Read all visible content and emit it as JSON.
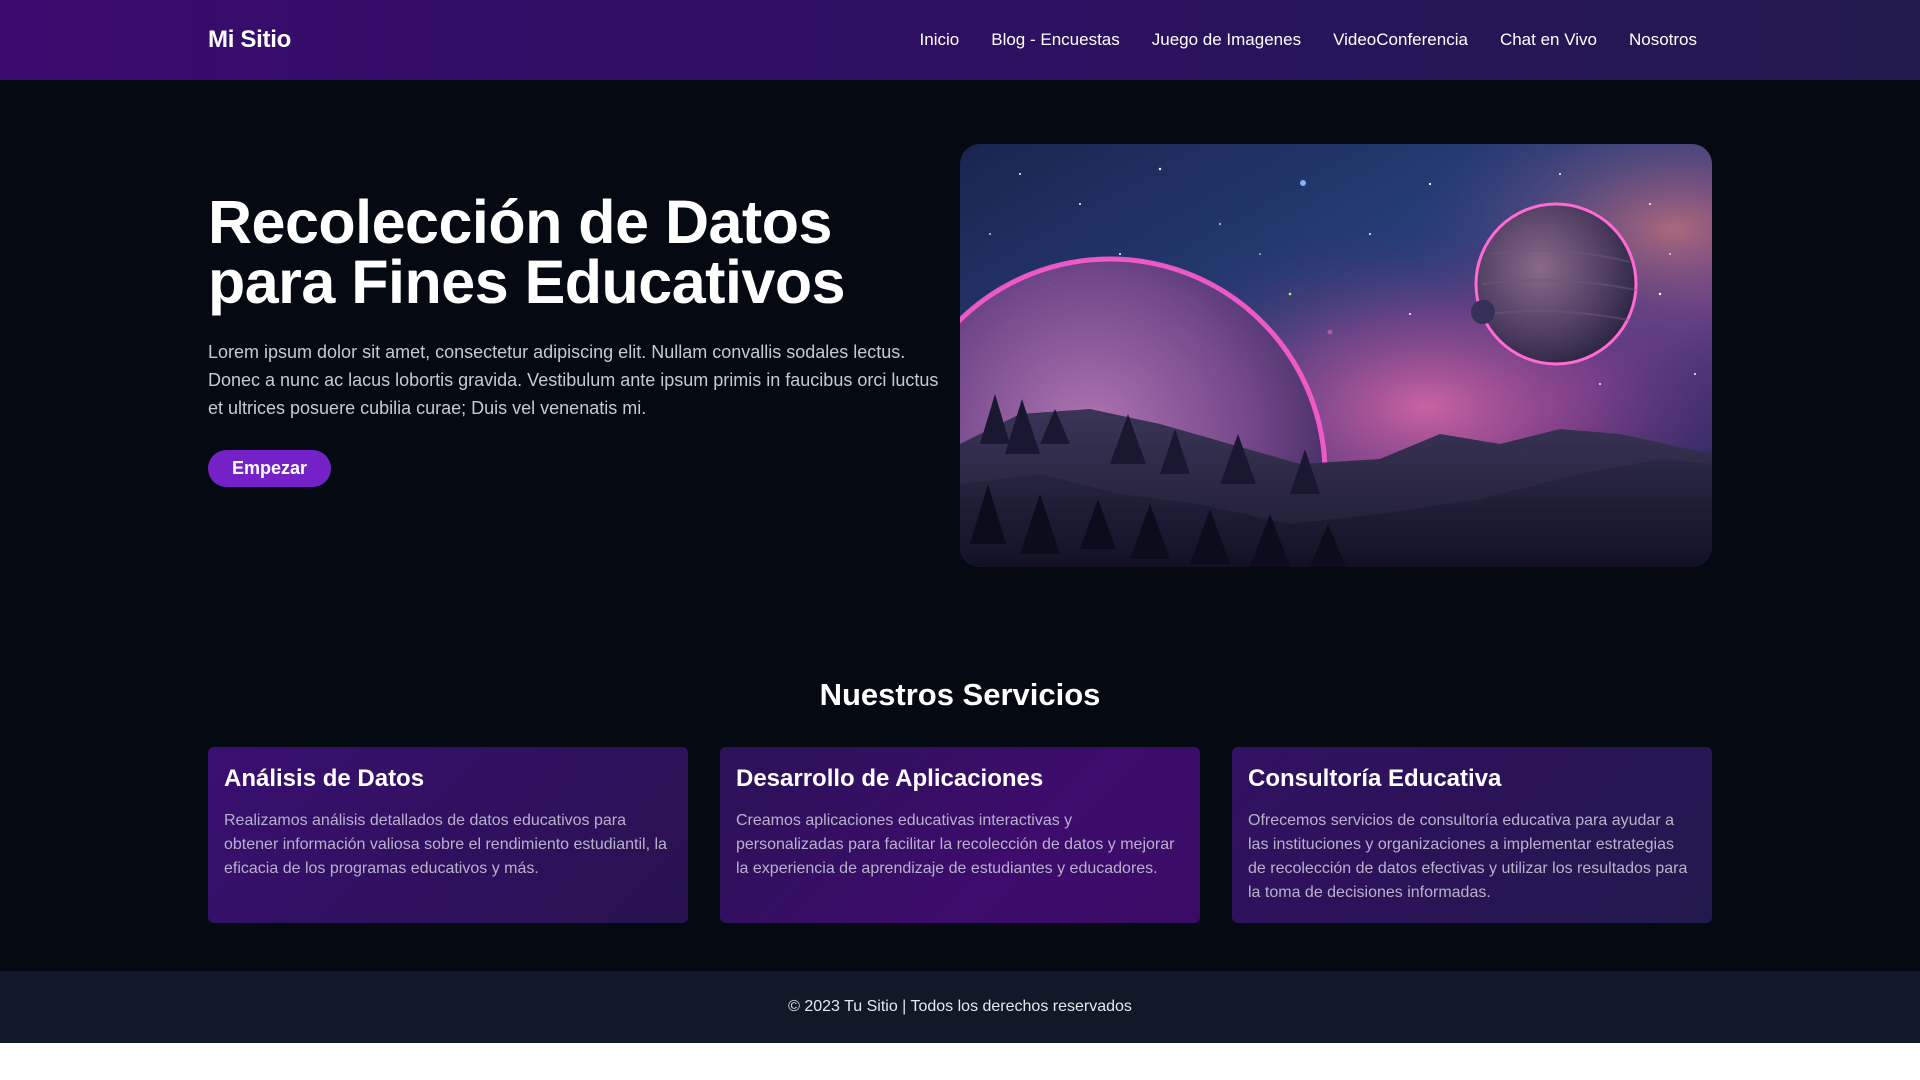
{
  "navbar": {
    "brand": "Mi Sitio",
    "links": [
      "Inicio",
      "Blog - Encuestas",
      "Juego de Imagenes",
      "VideoConferencia",
      "Chat en Vivo",
      "Nosotros"
    ]
  },
  "hero": {
    "title_line1": "Recolección de Datos",
    "title_line2": "para Fines Educativos",
    "description": "Lorem ipsum dolor sit amet, consectetur adipiscing elit. Nullam convallis sodales lectus. Donec a nunc ac lacus lobortis gravida. Vestibulum ante ipsum primis in faucibus orci luctus et ultrices posuere cubilia curae; Duis vel venenatis mi.",
    "button_label": "Empezar"
  },
  "services": {
    "title": "Nuestros Servicios",
    "cards": [
      {
        "title": "Análisis de Datos",
        "text": "Realizamos análisis detallados de datos educativos para obtener información valiosa sobre el rendimiento estudiantil, la eficacia de los programas educativos y más."
      },
      {
        "title": "Desarrollo de Aplicaciones",
        "text": "Creamos aplicaciones educativas interactivas y personalizadas para facilitar la recolección de datos y mejorar la experiencia de aprendizaje de estudiantes y educadores."
      },
      {
        "title": "Consultoría Educativa",
        "text": "Ofrecemos servicios de consultoría educativa para ayudar a las instituciones y organizaciones a implementar estrategias de recolección de datos efectivas y utilizar los resultados para la toma de decisiones informadas."
      }
    ]
  },
  "footer": {
    "text": "© 2023 Tu Sitio | Todos los derechos reservados"
  },
  "colors": {
    "navbar_start": "#3b0a6e",
    "page_bg": "#050912",
    "accent_button": "#7422c7",
    "footer_bg": "#111827"
  }
}
